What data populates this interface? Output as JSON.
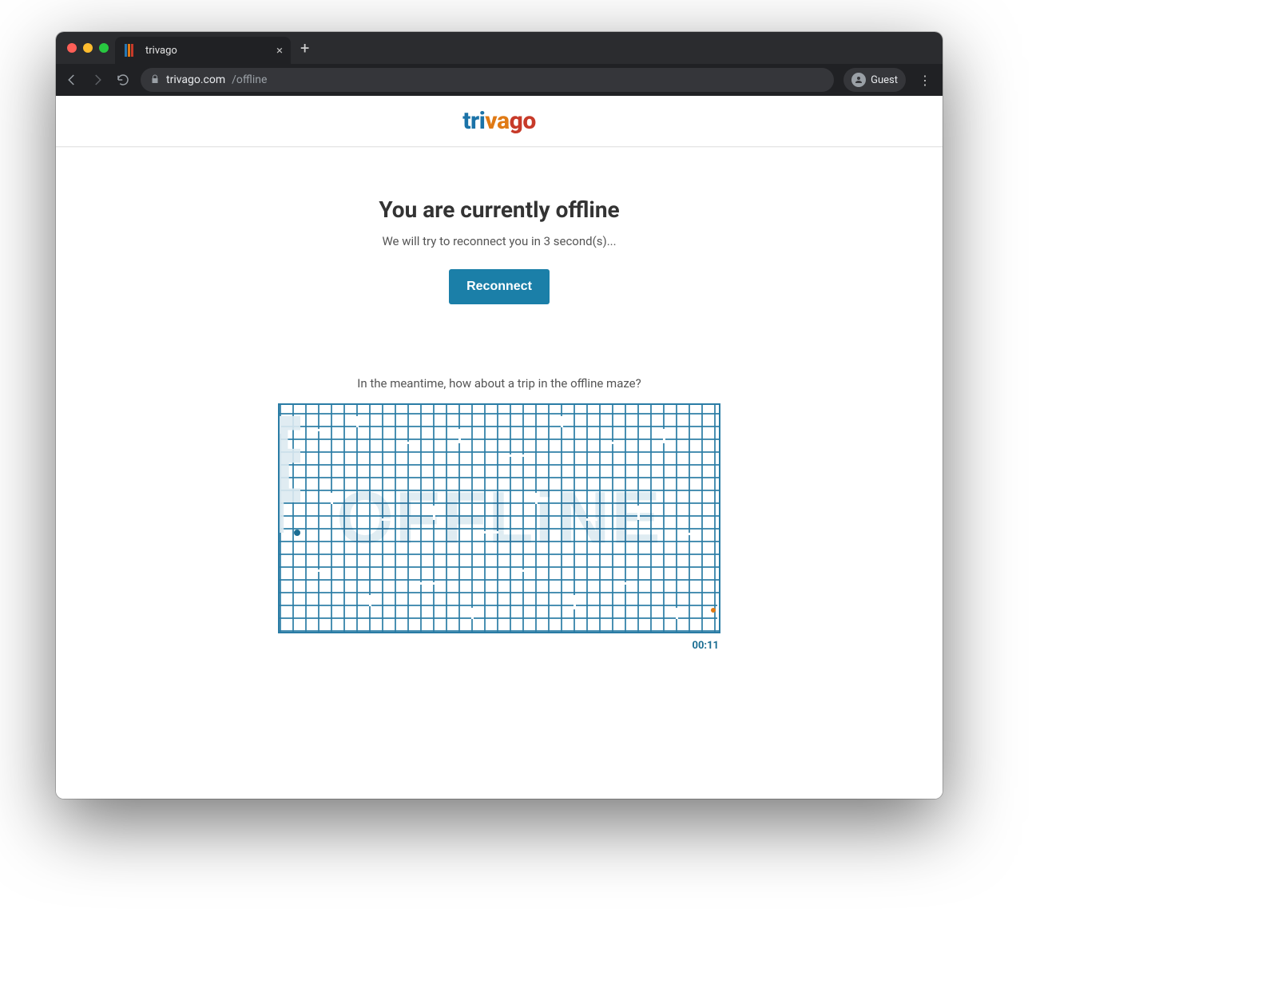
{
  "browser": {
    "tab_title": "trivago",
    "tab_close_glyph": "×",
    "newtab_glyph": "+",
    "url_host": "trivago.com",
    "url_path": "/offline",
    "guest_label": "Guest",
    "kebab_glyph": "⋮"
  },
  "brand": {
    "logo_parts": {
      "t": "t",
      "r": "r",
      "i": "i",
      "v": "v",
      "a": "a",
      "g": "g",
      "o": "o"
    }
  },
  "content": {
    "heading": "You are currently offline",
    "subtext": "We will try to reconnect you in 3 second(s)...",
    "button_label": "Reconnect",
    "maze_caption": "In the meantime, how about a trip in the offline maze?",
    "maze_word": "OFFLiNE",
    "timer": "00:11"
  }
}
